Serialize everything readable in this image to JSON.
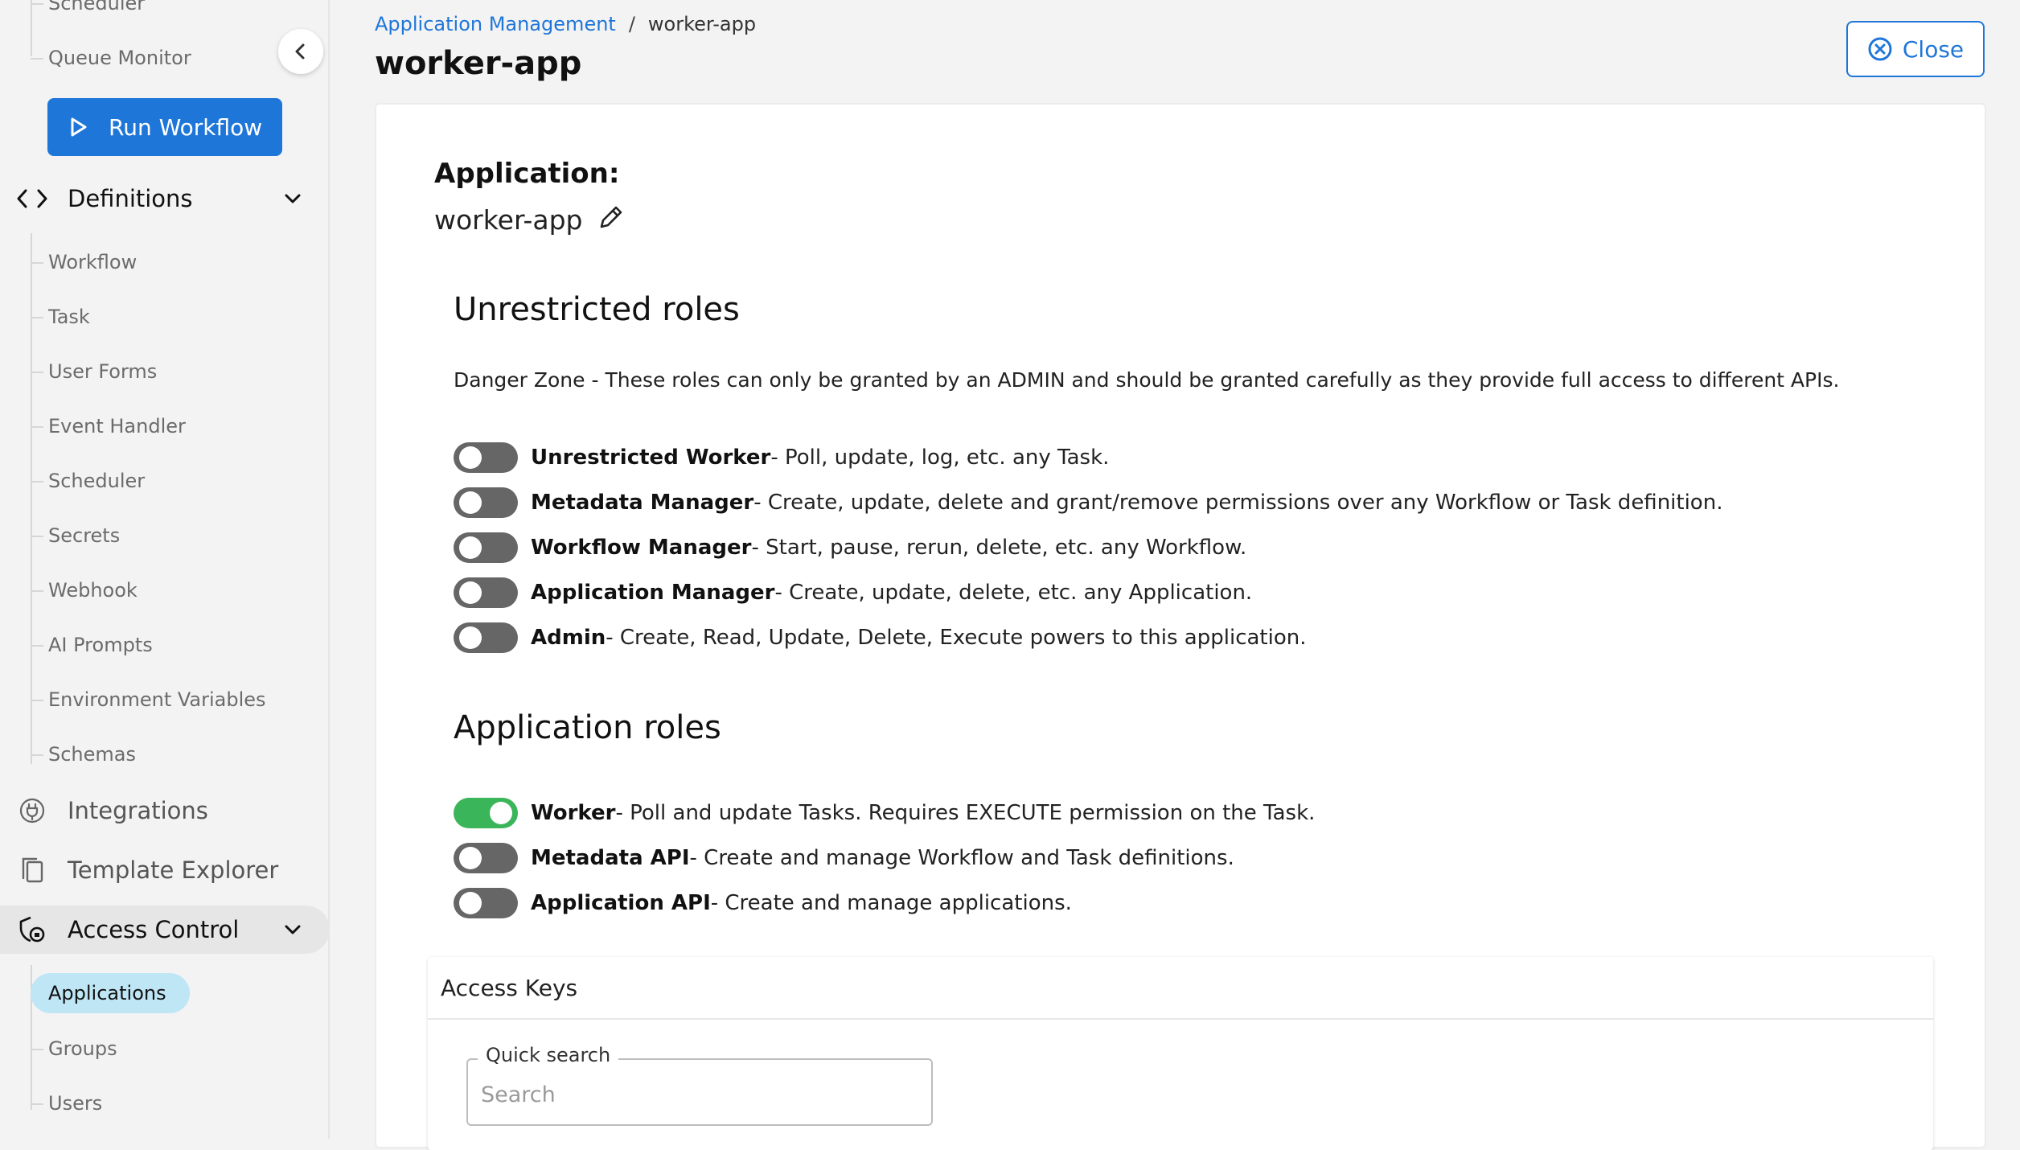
{
  "sidebar": {
    "top_items": [
      "Scheduler",
      "Queue Monitor"
    ],
    "run_button": "Run Workflow",
    "definitions": {
      "label": "Definitions",
      "items": [
        "Workflow",
        "Task",
        "User Forms",
        "Event Handler",
        "Scheduler",
        "Secrets",
        "Webhook",
        "AI Prompts",
        "Environment Variables",
        "Schemas"
      ]
    },
    "integrations": "Integrations",
    "template_explorer": "Template Explorer",
    "access_control": {
      "label": "Access Control",
      "items": [
        "Applications",
        "Groups",
        "Users"
      ],
      "active_item": "Applications"
    }
  },
  "breadcrumb": {
    "parent": "Application Management",
    "separator": "/",
    "current": "worker-app"
  },
  "page_title": "worker-app",
  "close_button": "Close",
  "application": {
    "label": "Application:",
    "name": "worker-app"
  },
  "unrestricted": {
    "title": "Unrestricted roles",
    "warning": "Danger Zone - These roles can only be granted by an ADMIN and should be granted carefully as they provide full access to different APIs.",
    "roles": [
      {
        "name": "Unrestricted Worker",
        "desc": " - Poll, update, log, etc. any Task.",
        "enabled": false
      },
      {
        "name": "Metadata Manager",
        "desc": " - Create, update, delete and grant/remove permissions over any Workflow or Task definition.",
        "enabled": false
      },
      {
        "name": "Workflow Manager",
        "desc": " - Start, pause, rerun, delete, etc. any Workflow.",
        "enabled": false
      },
      {
        "name": "Application Manager",
        "desc": " - Create, update, delete, etc. any Application.",
        "enabled": false
      },
      {
        "name": "Admin",
        "desc": " - Create, Read, Update, Delete, Execute powers to this application.",
        "enabled": false
      }
    ]
  },
  "application_roles": {
    "title": "Application roles",
    "roles": [
      {
        "name": "Worker",
        "desc": " - Poll and update Tasks. Requires EXECUTE permission on the Task.",
        "enabled": true
      },
      {
        "name": "Metadata API",
        "desc": " - Create and manage Workflow and Task definitions.",
        "enabled": false
      },
      {
        "name": "Application API",
        "desc": " - Create and manage applications.",
        "enabled": false
      }
    ]
  },
  "access_keys": {
    "title": "Access Keys",
    "search_label": "Quick search",
    "search_placeholder": "Search"
  },
  "colors": {
    "accent": "#1f76d9",
    "toggle_on": "#3bb55a",
    "toggle_off": "#666666",
    "active_pill": "#bfe6f5"
  }
}
